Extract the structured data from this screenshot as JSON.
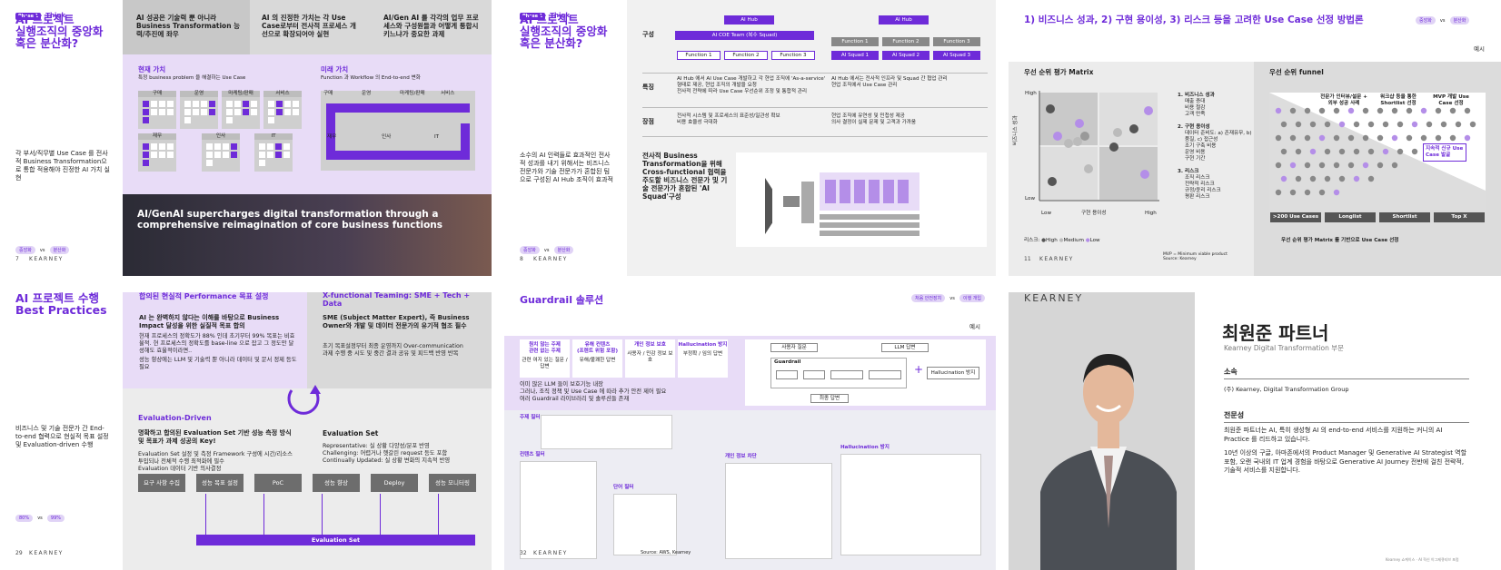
{
  "colors": {
    "accent": "#6e2bd9",
    "lavender": "#e8dcf7",
    "gray": "#d9d9d9"
  },
  "p1": {
    "title": "AI 프로젝트\n실행조직의 중앙화\n혹은 분산화?",
    "phase": "Phase 1",
    "think": "Think",
    "body": "각 부서/직무별 Use Case 를 전사적 Business Transformation으로 통합 적용해야 진정한 AI 가치 실현",
    "pg": "7",
    "tag1": "중앙화",
    "tag2": "분산화",
    "kearney": "KEARNEY",
    "h1": "AI 성공은 기술력 뿐 아니라 Business Transformation 능력/추진에 좌우",
    "h2": "AI 의 진정한 가치는 각 Use Case로부터 전사적 프로세스 개선으로 확장되어야 실현",
    "h3": "AI/Gen AI 를 각각의 업무 프로세스와 구성원들과 어떻게 통합시키느냐가 중요한 과제",
    "cur_t": "현재 가치",
    "cur_s": "특정 business problem 을 해결하는 Use Case",
    "fut_t": "미래 가치",
    "fut_s": "Function 과 Workflow 의 End-to-end 변화",
    "cur_labels": [
      "구매",
      "운영",
      "마케팅/판매",
      "서비스",
      "재무",
      "인사",
      "IT"
    ],
    "fut_labels": [
      "구매",
      "운영",
      "마케팅/판매",
      "서비스",
      "재무",
      "인사",
      "IT"
    ],
    "banner": "AI/GenAI supercharges digital transformation through a comprehensive reimagination of core business functions"
  },
  "p2": {
    "phase": "Phase 1",
    "think": "Think",
    "title": "AI 프로젝트\n실행조직의 중앙화\n혹은 분산화?",
    "body": "소수의 AI 인력들로 효과적인 전사적 성과를 내기 위해서는 비즈니스 전문가와 기술 전문가가 혼합된 팀으로 구성된 AI Hub 조직이 효과적",
    "pg": "8",
    "tag1": "중앙화",
    "tag2": "분산화",
    "kearney": "KEARNEY",
    "row1": "구성",
    "row2": "특징",
    "row3": "장점",
    "hub": "AI Hub",
    "coe": "AI COE Team (복수 Squad)",
    "fn": [
      "Function 1",
      "Function 2",
      "Function 3"
    ],
    "sq": [
      "AI Squad 1",
      "AI Squad 2",
      "AI Squad 3"
    ],
    "l_feat": [
      "AI Hub 에서 AI Use Case 개발하고 각 현업 조직에 'As-a-service' 형태로 제공, 현업 조직의 개발을 요청",
      "전사적 전략에 따라 Use Case 우선순위 조정 및 통합적 관리"
    ],
    "r_feat": [
      "AI Hub 에서는 전사적 인프라 및 Squad 간 협업 관리",
      "현업 조직에서 Use Case 관리"
    ],
    "l_adv": [
      "전사적 시스템 및 프로세스의 표준성/일관성 확보",
      "비용 효율성 극대화"
    ],
    "r_adv": [
      "현업 조직에 유연성 및 민첩성 제공",
      "의사 결정이 실제 문제 및 고객과 가까움"
    ],
    "bold": "전사적 Business Transformation을 위해 Cross-functional 협력을 주도할 비즈니스 전문가 및 기술 전문가가 혼합된 'AI Squad'구성"
  },
  "p3": {
    "title": "1) 비즈니스 성과, 2) 구현 용이성, 3) 리스크 등을 고려한 Use Case 선정 방법론",
    "ex": "예시",
    "t1": "중앙화",
    "t2": "분산화",
    "matrix": "우선 순위 평가 Matrix",
    "funnel": "우선 순위 funnel",
    "high": "High",
    "low": "Low",
    "yax": "비즈니스 성과",
    "xax": "구현 용이성",
    "c1": "1. 비즈니스 성과",
    "c1i": [
      "매출 증대",
      "비용 절감",
      "고객 만족"
    ],
    "c2": "2. 구현 용이성",
    "c2i": [
      "데이터 준비도: a) 존재유무, b) 품질, c) 접근성",
      "조기 구축 비용",
      "운영 비용",
      "구현 기간"
    ],
    "c3": "3. 리스크",
    "c3i": [
      "조직 리스크",
      "전략적 리스크",
      "규정/윤리 리스크",
      "평판 리스크"
    ],
    "leg": "리스크:",
    "lh": "High",
    "lm": "Medium",
    "ll": "Low",
    "f1": "전문가 인터뷰/설문 + 외부 성공 사례",
    "f2": "워크샵 등을 통한 Shortlist 선정",
    "f3": "MVP 개발 Use Case 선정",
    "f4": "지속적 신규 Use Case 발굴",
    "fb": [
      ">200 Use Cases",
      "Longlist",
      "Shortlist",
      "Top X"
    ],
    "fnote": "우선 순위 평가 Matrix 를 기반으로 Use Case 선정",
    "pg": "11",
    "kearney": "KEARNEY",
    "src": "MVP = Minimum viable product\nSource: Kearney"
  },
  "p4": {
    "title": "AI 프로젝트 수행\nBest Practices",
    "body": "비즈니스 및 기술 전문가 간 End-to-end 협력으로 현실적 목표 설정 및 Evaluation-driven 수행",
    "pg": "29",
    "kearney": "KEARNEY",
    "t1": "80%",
    "t2": "99%",
    "a_t": "합의된 현실적 Performance 목표 설정",
    "a_b": "AI 는 완벽하지 않다는 이해를 바탕으로 Business Impact 달성을 위한 실질적 목표 합의",
    "a_i": [
      "현재 프로세스의 정확도가 88% 인데 초기부터 99% 목표는 비효율적. 현 프로세스의 정확도를 base-line 으로 잡고 그 정도만 달성해도 효율적이라면..",
      "성능 향상에는 LLM 및 기술력 뿐 아니라 데이터 및 문서 정제 등도 필요"
    ],
    "b_t": "X-functional Teaming: SME + Tech + Data",
    "b_b": "SME (Subject Matter Expert), 즉 Business Owner와 개발 및 데이터 전문가의 유기적 협조 필수",
    "b_i": [
      "초기 목표설정부터 최종 운영까지 Over-communication",
      "과제 수행 중 시도 및 중간 결과 공유 및 피드백 반영 반복"
    ],
    "c_t": "Evaluation-Driven",
    "c_b": "명확하고 합의된 Evaluation Set 기반 성능 측정 방식 및 목표가 과제 성공의 Key!",
    "c_i": [
      "Evaluation Set 설정 및 측정 Framework 구성에 시간/리소스 투입되나 전체적 수행 최적화에 필수",
      "Evaluation 데이터 기반 의사결정"
    ],
    "d_t": "Evaluation Set",
    "d_i": [
      "Representative: 실 상황 다양성/분포 반영",
      "Challenging: 어렵거나 헷갈린 request 등도 포함",
      "Continually Updated: 실 상황 변화의 지속적 반영"
    ],
    "steps": [
      "요구 사항 수집",
      "성능 목표 설정",
      "PoC",
      "성능 향상",
      "Deploy",
      "성능 모니터링"
    ],
    "eval": "Evaluation Set"
  },
  "p5": {
    "title": "Guardrail 솔루션",
    "ex": "예시",
    "t1": "처음 안전장치",
    "t2": "이행 개입",
    "pg": "32",
    "kearney": "KEARNEY",
    "src": "Source: AWS, Kearney",
    "cats": [
      {
        "h": "원치 않는 주제\n관련 없는 주제",
        "s": "관련 여지 있는 질문 / 답변"
      },
      {
        "h": "유해 컨텐츠\n(프렌트 위험 포함)",
        "s": "유해/불쾌한 답변"
      },
      {
        "h": "개인 정보 보호",
        "s": "사용자 / 민감 정보 보호"
      },
      {
        "h": "Hallucination 방지",
        "s": "부정확 / 임의 답변"
      }
    ],
    "bul": [
      "이미 많은 LLM 들이 보호기능 내장",
      "그러나, 조직 정책 및 Use Case 에 따라 추가 안전 제어 필요",
      "여러 Guardrail 라이브러리 및 솔루션들 존재"
    ],
    "s1": "주제 필터",
    "s2": "컨텐츠 필터",
    "s3": "단어 필터",
    "s4": "개인 정보 차단",
    "s5": "Hallucination 방지",
    "d_user": "사용자 질문",
    "d_llm": "LLM 답변",
    "d_g": "Guardrail",
    "d_h": "Hallucination 방지",
    "d_out": "최종 답변"
  },
  "p6": {
    "kearney": "KEARNEY",
    "name": "최원준 파트너",
    "sub": "Kearney Digital Transformation 부문",
    "aff_t": "소속",
    "aff": "(주) Kearney, Digital Transformation Group",
    "exp_t": "전문성",
    "exp": [
      "최원준 파트너는 AI, 특히 생성형 AI 의 end-to-end 서비스를 지원하는 커니의 AI Practice 를 리드하고 있습니다.",
      "10년 이상의 구글, 아마존에서의 Product Manager 및 Generative AI Strategist 역할 포함, 오랜 국내외 IT 업계 경험을 바탕으로 Generative AI Journey 전반에 걸친 전략적, 기술적 서비스를 지원합니다."
    ],
    "foot": "Kearney 쇼케이스 · AI 혁신 이그제큐티브 포럼"
  }
}
